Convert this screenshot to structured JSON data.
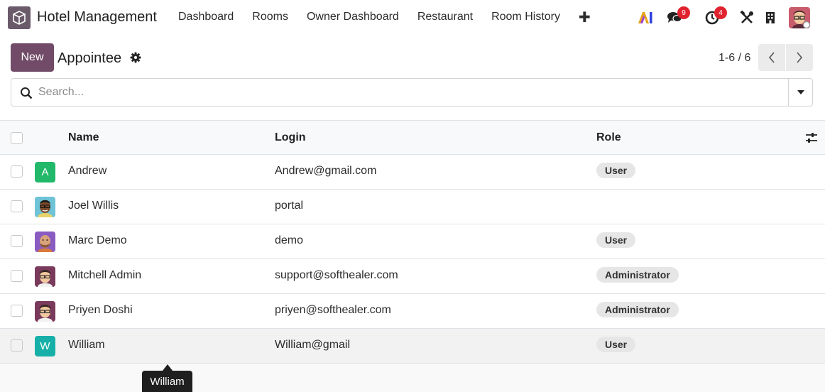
{
  "navbar": {
    "app_name": "Hotel Management",
    "menu": [
      "Dashboard",
      "Rooms",
      "Owner Dashboard",
      "Restaurant",
      "Room History"
    ],
    "add_icon": "plus-icon",
    "systray": {
      "ai_icon": "ai-icon",
      "messages_icon": "chat-bubbles-icon",
      "messages_count": "9",
      "activity_icon": "clock-icon",
      "activity_count": "4",
      "tools_icon": "tools-icon",
      "company_icon": "building-icon",
      "user_avatar_icon": "user-avatar"
    }
  },
  "control": {
    "new_label": "New",
    "title": "Appointee",
    "settings_icon": "gear-icon",
    "pager": "1-6 / 6",
    "search_placeholder": "Search..."
  },
  "table": {
    "headers": {
      "name": "Name",
      "login": "Login",
      "role": "Role"
    },
    "rows": [
      {
        "name": "Andrew",
        "login": "Andrew@gmail.com",
        "role": "User",
        "avatar_letter": "A",
        "avatar_color": "#21b86a"
      },
      {
        "name": "Joel Willis",
        "login": "portal",
        "role": "",
        "avatar_color": "#6fc3d6"
      },
      {
        "name": "Marc Demo",
        "login": "demo",
        "role": "User",
        "avatar_color": "#8a5cc2"
      },
      {
        "name": "Mitchell Admin",
        "login": "support@softhealer.com",
        "role": "Administrator",
        "avatar_color": "#7a3a5c"
      },
      {
        "name": "Priyen Doshi",
        "login": "priyen@softhealer.com",
        "role": "Administrator",
        "avatar_color": "#7a3a5c"
      },
      {
        "name": "William",
        "login": "William@gmail",
        "role": "User",
        "avatar_letter": "W",
        "avatar_color": "#17b0a8"
      }
    ]
  },
  "tooltip": {
    "text": "William"
  },
  "colors": {
    "brand": "#714b67",
    "badge": "#e0232e",
    "tag_bg": "#e6e6e6"
  }
}
